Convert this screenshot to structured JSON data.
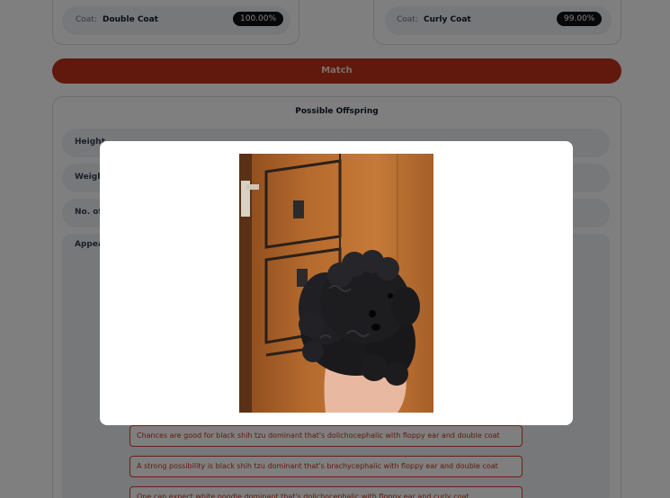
{
  "parent_cards": [
    {
      "coat_label": "Coat:",
      "coat_value": "Double Coat",
      "match_pct": "100.00%"
    },
    {
      "coat_label": "Coat:",
      "coat_value": "Curly Coat",
      "match_pct": "99.00%"
    }
  ],
  "match_button": "Match",
  "offspring": {
    "title": "Possible Offspring",
    "rows": [
      {
        "label": "Height"
      },
      {
        "label": "Weigh"
      },
      {
        "label": "No. of"
      }
    ],
    "appearance_label": "Appea",
    "outcomes": [
      "Chances are good for black shih tzu dominant that's dolichocephalic with floppy ear and double coat",
      "A strong possibility is black shih tzu dominant that's brachycephalic with floppy ear and double coat",
      "One can expect white poodle dominant that's dolichocephalic with floppy ear and curly coat"
    ]
  },
  "modal": {
    "image": "black-curly-puppy-photo"
  },
  "colors": {
    "accent": "#c2331b",
    "overlay": "rgba(0,0,0,0.5)"
  }
}
